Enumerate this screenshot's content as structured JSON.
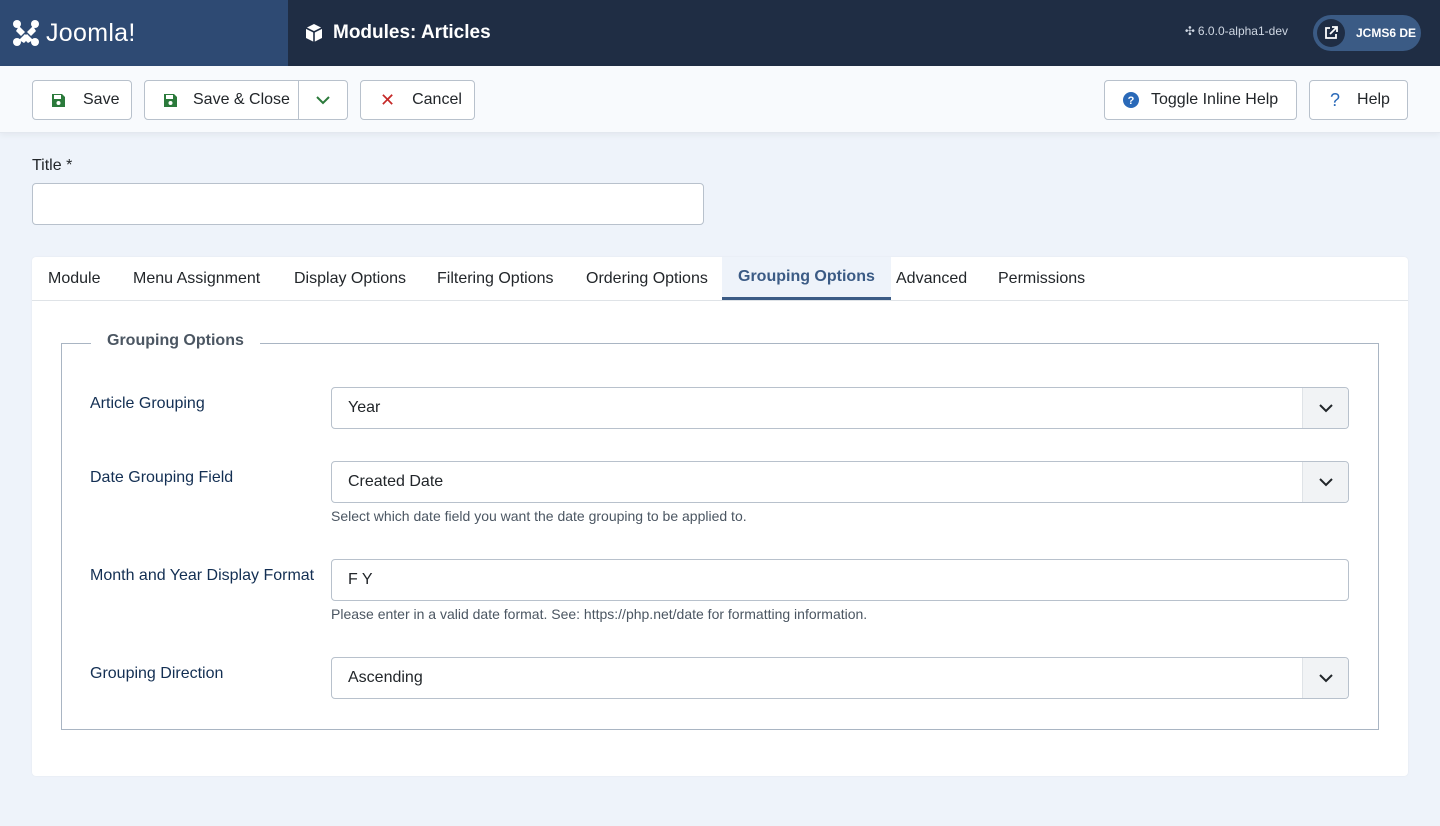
{
  "header": {
    "brand_name": "Joomla!",
    "page_title": "Modules: Articles",
    "version": "6.0.0-alpha1-dev",
    "site_label": "JCMS6 DE"
  },
  "toolbar": {
    "save_label": "Save",
    "save_close_label": "Save & Close",
    "cancel_label": "Cancel",
    "toggle_help_label": "Toggle Inline Help",
    "help_label": "Help"
  },
  "form": {
    "title_label": "Title *",
    "title_value": ""
  },
  "tabs": [
    {
      "label": "Module"
    },
    {
      "label": "Menu Assignment"
    },
    {
      "label": "Display Options"
    },
    {
      "label": "Filtering Options"
    },
    {
      "label": "Ordering Options"
    },
    {
      "label": "Grouping Options"
    },
    {
      "label": "Advanced"
    },
    {
      "label": "Permissions"
    }
  ],
  "active_tab": "Grouping Options",
  "grouping": {
    "legend": "Grouping Options",
    "fields": [
      {
        "label": "Article Grouping",
        "value": "Year",
        "description": ""
      },
      {
        "label": "Date Grouping Field",
        "value": "Created Date",
        "description": "Select which date field you want the date grouping to be applied to."
      },
      {
        "label": "Month and Year Display Format",
        "value": "F Y",
        "description": "Please enter in a valid date format. See: https://php.net/date for formatting information."
      },
      {
        "label": "Grouping Direction",
        "value": "Ascending",
        "description": ""
      }
    ]
  }
}
